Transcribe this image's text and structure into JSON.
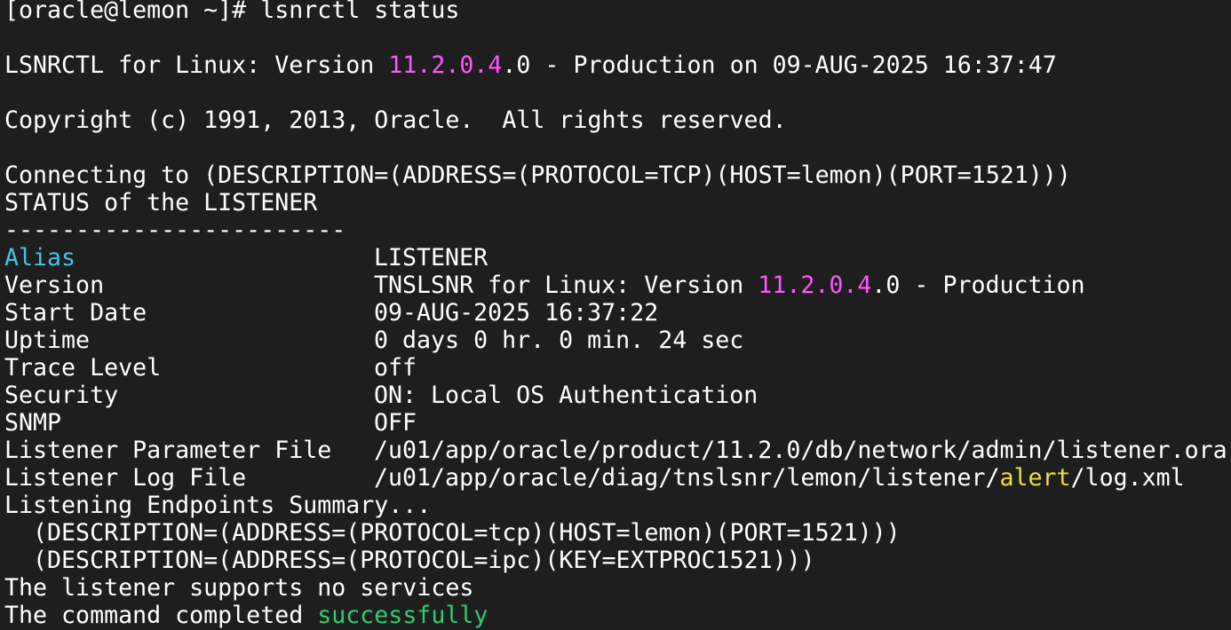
{
  "colors": {
    "background": "#1e1e1e",
    "foreground": "#ffffff",
    "version_highlight": "#ff55ff",
    "alias_highlight": "#3ec6e8",
    "alert_highlight": "#e8e03a",
    "success_highlight": "#2ecc71"
  },
  "prompt": {
    "text": "[oracle@lemon ~]# ",
    "command": "lsnrctl status"
  },
  "banner": {
    "prefix": "LSNRCTL for Linux: Version ",
    "version_hl": "11.2.0.4",
    "suffix": ".0 - Production on 09-AUG-2025 16:37:47"
  },
  "copyright": "Copyright (c) 1991, 2013, Oracle.  All rights reserved.",
  "connecting": "Connecting to (DESCRIPTION=(ADDRESS=(PROTOCOL=TCP)(HOST=lemon)(PORT=1521)))",
  "status_header": "STATUS of the LISTENER",
  "separator": "------------------------",
  "fields": {
    "alias": {
      "label": "Alias",
      "value": "LISTENER"
    },
    "version": {
      "label": "Version",
      "prefix": "TNSLSNR for Linux: Version ",
      "version_hl": "11.2.0.4",
      "suffix": ".0 - Production"
    },
    "start_date": {
      "label": "Start Date",
      "value": "09-AUG-2025 16:37:22"
    },
    "uptime": {
      "label": "Uptime",
      "value": "0 days 0 hr. 0 min. 24 sec"
    },
    "trace_level": {
      "label": "Trace Level",
      "value": "off"
    },
    "security": {
      "label": "Security",
      "value": "ON: Local OS Authentication"
    },
    "snmp": {
      "label": "SNMP",
      "value": "OFF"
    },
    "param_file": {
      "label": "Listener Parameter File",
      "value": "/u01/app/oracle/product/11.2.0/db/network/admin/listener.ora"
    },
    "log_file": {
      "label": "Listener Log File",
      "prefix": "/u01/app/oracle/diag/tnslsnr/lemon/listener/",
      "alert_hl": "alert",
      "suffix": "/log.xml"
    }
  },
  "endpoints_header": "Listening Endpoints Summary...",
  "endpoints": [
    "  (DESCRIPTION=(ADDRESS=(PROTOCOL=tcp)(HOST=lemon)(PORT=1521)))",
    "  (DESCRIPTION=(ADDRESS=(PROTOCOL=ipc)(KEY=EXTPROC1521)))"
  ],
  "no_services": "The listener supports no services",
  "completed": {
    "prefix": "The command completed ",
    "success_hl": "successfully"
  }
}
